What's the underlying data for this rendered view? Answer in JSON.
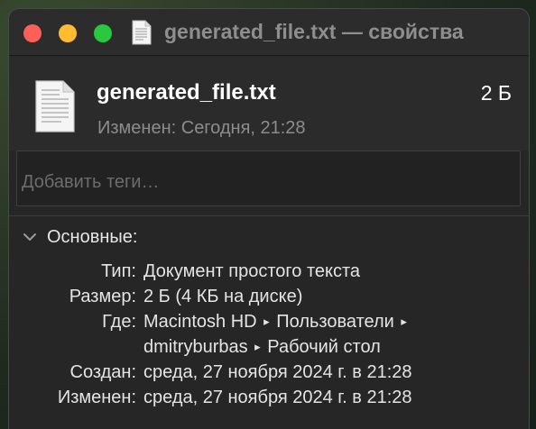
{
  "window": {
    "title": "generated_file.txt — свойства"
  },
  "header": {
    "file_name": "generated_file.txt",
    "file_size": "2 Б",
    "modified": "Изменен: Сегодня, 21:28"
  },
  "tags": {
    "placeholder": "Добавить теги…"
  },
  "general": {
    "title": "Основные:",
    "kind_label": "Тип:",
    "kind_value": "Документ простого текста",
    "size_label": "Размер:",
    "size_value": "2 Б (4 КБ на диске)",
    "where_label": "Где:",
    "where_part1": "Macintosh HD",
    "where_part2": "Пользователи",
    "where_part3": "dmitryburbas",
    "where_part4": "Рабочий стол",
    "created_label": "Создан:",
    "created_value": "среда, 27 ноября 2024 г. в 21:28",
    "modified_label": "Изменен:",
    "modified_value": "среда, 27 ноября 2024 г. в 21:28"
  },
  "colors": {
    "close": "#fe5f57",
    "minimize": "#febc2e",
    "maximize": "#28c840",
    "window_bg": "#262626",
    "text": "#e4e4e4",
    "secondary_text": "#8c8c8c"
  },
  "icons": {
    "title_icon": "text-document-icon",
    "file_icon": "text-document-icon",
    "path_separator": "triangle-right-icon",
    "section_toggle": "chevron-down-icon"
  }
}
